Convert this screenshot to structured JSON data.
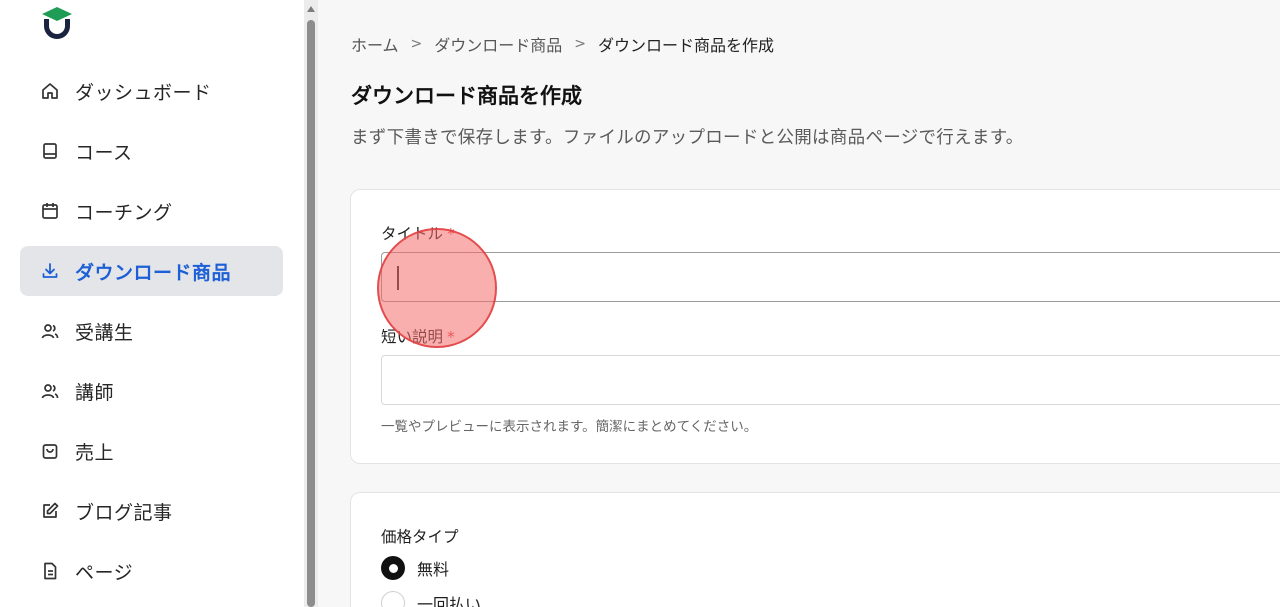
{
  "colors": {
    "accent": "#1d5fd6",
    "required": "#e23b3b",
    "active_bg": "#e4e5e8",
    "logo_green": "#1f9d55",
    "logo_navy": "#1a2340"
  },
  "sidebar": {
    "logo_icon": "graduation-cap-logo-icon",
    "items": [
      {
        "label": "ダッシュボード",
        "icon": "home-icon",
        "active": false
      },
      {
        "label": "コース",
        "icon": "book-icon",
        "active": false
      },
      {
        "label": "コーチング",
        "icon": "calendar-icon",
        "active": false
      },
      {
        "label": "ダウンロード商品",
        "icon": "download-icon",
        "active": true
      },
      {
        "label": "受講生",
        "icon": "users-icon",
        "active": false
      },
      {
        "label": "講師",
        "icon": "users-icon",
        "active": false
      },
      {
        "label": "売上",
        "icon": "shopping-bag-icon",
        "active": false
      },
      {
        "label": "ブログ記事",
        "icon": "edit-icon",
        "active": false
      },
      {
        "label": "ページ",
        "icon": "document-icon",
        "active": false
      }
    ]
  },
  "breadcrumb": {
    "home": "ホーム",
    "sep": ">",
    "parent": "ダウンロード商品",
    "current": "ダウンロード商品を作成"
  },
  "page": {
    "title": "ダウンロード商品を作成",
    "description": "まず下書きで保存します。ファイルのアップロードと公開は商品ページで行えます。"
  },
  "form": {
    "title_label": "タイトル",
    "title_value": "",
    "short_desc_label": "短い説明",
    "short_desc_value": "",
    "short_desc_help": "一覧やプレビューに表示されます。簡潔にまとめてください。",
    "required_mark": "*",
    "price_type_label": "価格タイプ",
    "price_options": [
      {
        "label": "無料",
        "selected": true
      },
      {
        "label": "一回払い",
        "selected": false
      }
    ]
  }
}
